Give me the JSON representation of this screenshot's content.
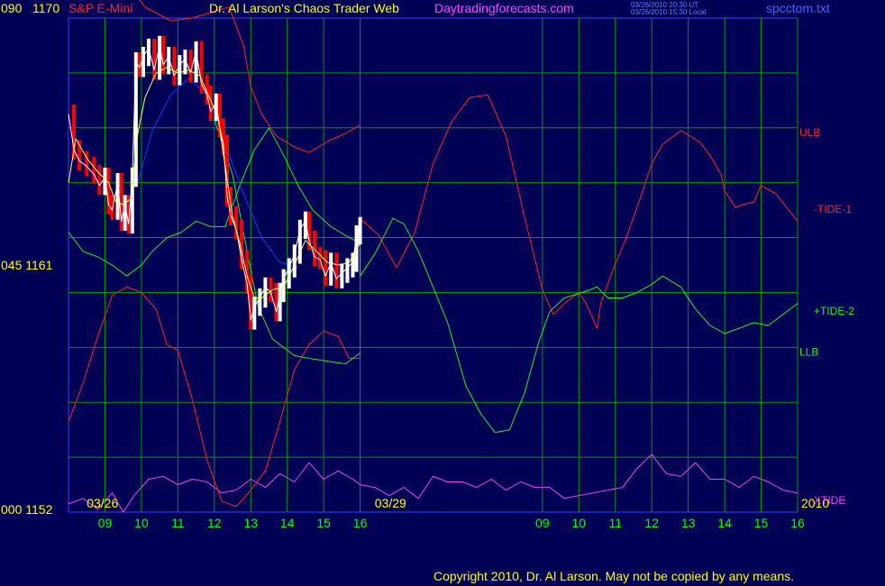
{
  "header": {
    "left_value": "090",
    "left_price": "1170",
    "symbol": "S&P E-Mini",
    "title": "Dr. Al Larson's Chaos Trader Web",
    "site": "Daytradingforecasts.com",
    "timestamp_ut": "03/26/2010 20:30 UT",
    "timestamp_local": "03/26/2010 15:30 Local",
    "filename": "spcctom.txt"
  },
  "footer": {
    "copyright": "Copyright 2010, Dr. Al Larson. May not be copied by any means."
  },
  "colors": {
    "background": "#000055",
    "grid": "#009900",
    "plot_border": "#3344ff",
    "price_up": "#ffffff",
    "price_down": "#ff0000",
    "average": "#ffff66",
    "ulb": "#ff2222",
    "tide1": "#ff2222",
    "tide2": "#22ee22",
    "llb": "#22ee22",
    "xtide": "#ee44ee",
    "slow_line": "#2233ff"
  },
  "chart_data": {
    "type": "line",
    "title": "S&P E-Mini",
    "y_left_ticks": [
      {
        "label": "090 1170",
        "value": 1170
      },
      {
        "label": "045 1161",
        "value": 1161
      },
      {
        "label": "000 1152",
        "value": 1152
      }
    ],
    "ylim": [
      1152,
      1170
    ],
    "x_hour_labels": [
      "09",
      "10",
      "11",
      "12",
      "13",
      "14",
      "15",
      "16",
      "09",
      "10",
      "11",
      "12",
      "13",
      "14",
      "15",
      "16"
    ],
    "date_labels": [
      "03/26",
      "03/29"
    ],
    "year_label": "2010",
    "series_labels": [
      "ULB",
      "-TIDE-1",
      "+TIDE-2",
      "LLB",
      "XTIDE"
    ],
    "session_close_x": 16.0,
    "price": [
      [
        8.0,
        1166.5
      ],
      [
        8.15,
        1165.2
      ],
      [
        8.3,
        1164.8
      ],
      [
        8.5,
        1164.6
      ],
      [
        8.7,
        1164.3
      ],
      [
        8.85,
        1163.9
      ],
      [
        9.0,
        1164.2
      ],
      [
        9.1,
        1163.2
      ],
      [
        9.2,
        1163.0
      ],
      [
        9.35,
        1164.0
      ],
      [
        9.45,
        1162.6
      ],
      [
        9.55,
        1163.2
      ],
      [
        9.65,
        1162.5
      ],
      [
        9.75,
        1164.2
      ],
      [
        9.85,
        1168.4
      ],
      [
        9.95,
        1168.2
      ],
      [
        10.05,
        1168.6
      ],
      [
        10.2,
        1168.9
      ],
      [
        10.35,
        1168.1
      ],
      [
        10.5,
        1169.0
      ],
      [
        10.6,
        1168.3
      ],
      [
        10.75,
        1168.6
      ],
      [
        10.9,
        1167.9
      ],
      [
        11.05,
        1168.3
      ],
      [
        11.2,
        1168.5
      ],
      [
        11.35,
        1168.0
      ],
      [
        11.5,
        1168.8
      ],
      [
        11.65,
        1167.6
      ],
      [
        11.8,
        1167.2
      ],
      [
        11.9,
        1166.6
      ],
      [
        12.05,
        1166.9
      ],
      [
        12.15,
        1166.0
      ],
      [
        12.25,
        1165.4
      ],
      [
        12.35,
        1163.5
      ],
      [
        12.45,
        1162.8
      ],
      [
        12.6,
        1162.3
      ],
      [
        12.75,
        1161.2
      ],
      [
        12.9,
        1160.3
      ],
      [
        13.0,
        1159.0
      ],
      [
        13.1,
        1159.5
      ],
      [
        13.25,
        1159.8
      ],
      [
        13.4,
        1160.2
      ],
      [
        13.55,
        1160.0
      ],
      [
        13.7,
        1159.3
      ],
      [
        13.8,
        1160.0
      ],
      [
        13.9,
        1160.5
      ],
      [
        14.05,
        1160.9
      ],
      [
        14.2,
        1161.4
      ],
      [
        14.35,
        1162.3
      ],
      [
        14.5,
        1162.6
      ],
      [
        14.6,
        1161.9
      ],
      [
        14.75,
        1161.3
      ],
      [
        14.9,
        1161.2
      ],
      [
        15.05,
        1160.6
      ],
      [
        15.2,
        1161.1
      ],
      [
        15.35,
        1160.5
      ],
      [
        15.5,
        1160.7
      ],
      [
        15.65,
        1160.9
      ],
      [
        15.8,
        1161.1
      ],
      [
        15.9,
        1162.1
      ],
      [
        16.0,
        1162.4
      ]
    ],
    "average": [
      [
        8.0,
        1164.0
      ],
      [
        8.2,
        1165.6
      ],
      [
        8.5,
        1164.9
      ],
      [
        8.8,
        1164.4
      ],
      [
        9.1,
        1164.0
      ],
      [
        9.3,
        1163.3
      ],
      [
        9.5,
        1163.2
      ],
      [
        9.7,
        1163.4
      ],
      [
        9.9,
        1165.8
      ],
      [
        10.1,
        1167.1
      ],
      [
        10.4,
        1168.0
      ],
      [
        10.7,
        1168.2
      ],
      [
        11.0,
        1168.0
      ],
      [
        11.3,
        1168.1
      ],
      [
        11.6,
        1167.9
      ],
      [
        11.9,
        1167.0
      ],
      [
        12.1,
        1166.4
      ],
      [
        12.3,
        1164.6
      ],
      [
        12.5,
        1162.8
      ],
      [
        12.7,
        1161.8
      ],
      [
        12.9,
        1160.6
      ],
      [
        13.1,
        1159.8
      ],
      [
        13.3,
        1159.8
      ],
      [
        13.6,
        1160.1
      ],
      [
        13.9,
        1160.2
      ],
      [
        14.2,
        1161.0
      ],
      [
        14.5,
        1161.9
      ],
      [
        14.8,
        1161.5
      ],
      [
        15.1,
        1161.1
      ],
      [
        15.4,
        1161.0
      ],
      [
        15.7,
        1161.1
      ],
      [
        16.0,
        1161.8
      ]
    ],
    "slow_line": [
      [
        9.9,
        1164.0
      ],
      [
        10.3,
        1165.9
      ],
      [
        10.8,
        1167.2
      ],
      [
        11.3,
        1167.8
      ],
      [
        11.8,
        1167.2
      ],
      [
        12.3,
        1165.4
      ],
      [
        12.8,
        1163.6
      ],
      [
        13.3,
        1162.0
      ],
      [
        13.8,
        1161.1
      ],
      [
        14.3,
        1160.9
      ]
    ],
    "ulb": [
      [
        9.7,
        1171.1
      ],
      [
        10.1,
        1170.4
      ],
      [
        10.8,
        1169.9
      ],
      [
        11.4,
        1170.0
      ],
      [
        11.9,
        1170.2
      ],
      [
        12.4,
        1170.4
      ],
      [
        12.8,
        1169.0
      ],
      [
        13.0,
        1167.5
      ],
      [
        13.3,
        1166.5
      ],
      [
        13.7,
        1165.7
      ],
      [
        14.2,
        1165.3
      ],
      [
        14.6,
        1165.1
      ],
      [
        15.1,
        1165.5
      ],
      [
        15.6,
        1165.8
      ],
      [
        16.0,
        1166.1
      ]
    ],
    "llb": [
      [
        12.0,
        1166.3
      ],
      [
        12.5,
        1164.3
      ],
      [
        12.9,
        1161.5
      ],
      [
        13.2,
        1159.5
      ],
      [
        13.6,
        1158.3
      ],
      [
        14.2,
        1157.7
      ],
      [
        14.6,
        1157.6
      ],
      [
        15.1,
        1157.5
      ],
      [
        15.6,
        1157.4
      ],
      [
        16.0,
        1157.8
      ]
    ],
    "tide1": [
      [
        8.0,
        1155.3
      ],
      [
        8.4,
        1156.7
      ],
      [
        8.8,
        1158.4
      ],
      [
        9.2,
        1159.9
      ],
      [
        9.6,
        1160.2
      ],
      [
        10.0,
        1160.0
      ],
      [
        10.4,
        1159.4
      ],
      [
        10.7,
        1158.1
      ],
      [
        11.0,
        1157.9
      ],
      [
        11.4,
        1156.1
      ],
      [
        11.8,
        1153.9
      ],
      [
        12.2,
        1152.4
      ],
      [
        12.6,
        1152.2
      ],
      [
        13.0,
        1152.8
      ],
      [
        13.4,
        1153.5
      ],
      [
        13.8,
        1155.3
      ],
      [
        14.2,
        1157.2
      ],
      [
        14.6,
        1158.1
      ],
      [
        15.0,
        1158.6
      ],
      [
        15.4,
        1158.4
      ],
      [
        15.7,
        1157.6
      ],
      [
        16.0,
        1157.6
      ],
      [
        16.0,
        1162.7
      ],
      [
        16.5,
        1162.1
      ],
      [
        17.0,
        1160.9
      ],
      [
        17.5,
        1162.2
      ],
      [
        18.0,
        1164.7
      ],
      [
        18.5,
        1166.2
      ],
      [
        19.0,
        1167.1
      ],
      [
        19.5,
        1167.2
      ],
      [
        20.0,
        1165.7
      ],
      [
        20.5,
        1162.8
      ],
      [
        21.0,
        1160.1
      ],
      [
        21.3,
        1159.2
      ],
      [
        21.6,
        1159.6
      ],
      [
        22.0,
        1160.0
      ],
      [
        22.2,
        1159.6
      ],
      [
        22.5,
        1158.7
      ],
      [
        22.6,
        1159.6
      ],
      [
        22.9,
        1160.7
      ],
      [
        23.3,
        1162.0
      ],
      [
        23.7,
        1163.5
      ],
      [
        24.0,
        1164.7
      ],
      [
        24.3,
        1165.4
      ],
      [
        24.8,
        1165.9
      ],
      [
        25.3,
        1165.5
      ],
      [
        25.6,
        1165.0
      ],
      [
        25.9,
        1164.3
      ],
      [
        26.0,
        1163.7
      ],
      [
        26.3,
        1163.1
      ],
      [
        26.5,
        1163.2
      ],
      [
        26.8,
        1163.3
      ],
      [
        27.0,
        1163.9
      ],
      [
        27.4,
        1163.6
      ],
      [
        27.7,
        1163.1
      ],
      [
        28.0,
        1162.6
      ]
    ],
    "tide2": [
      [
        8.0,
        1162.2
      ],
      [
        8.4,
        1161.5
      ],
      [
        8.8,
        1161.3
      ],
      [
        9.2,
        1161.0
      ],
      [
        9.6,
        1160.6
      ],
      [
        10.0,
        1161.0
      ],
      [
        10.3,
        1161.5
      ],
      [
        10.7,
        1162.0
      ],
      [
        11.1,
        1162.2
      ],
      [
        11.5,
        1162.6
      ],
      [
        11.9,
        1162.4
      ],
      [
        12.3,
        1162.4
      ],
      [
        12.7,
        1163.9
      ],
      [
        13.1,
        1165.2
      ],
      [
        13.5,
        1166.0
      ],
      [
        13.9,
        1165.0
      ],
      [
        14.3,
        1163.9
      ],
      [
        14.7,
        1163.0
      ],
      [
        15.2,
        1162.4
      ],
      [
        15.7,
        1162.0
      ],
      [
        16.0,
        1161.8
      ],
      [
        16.0,
        1160.6
      ],
      [
        16.4,
        1161.4
      ],
      [
        16.9,
        1162.7
      ],
      [
        17.2,
        1162.5
      ],
      [
        17.6,
        1161.5
      ],
      [
        18.0,
        1160.2
      ],
      [
        18.4,
        1158.9
      ],
      [
        18.9,
        1156.6
      ],
      [
        19.3,
        1155.6
      ],
      [
        19.7,
        1154.9
      ],
      [
        20.1,
        1155.0
      ],
      [
        20.5,
        1156.3
      ],
      [
        20.9,
        1158.2
      ],
      [
        21.2,
        1159.3
      ],
      [
        21.6,
        1159.8
      ],
      [
        22.1,
        1160.0
      ],
      [
        22.5,
        1160.2
      ],
      [
        22.8,
        1159.8
      ],
      [
        23.2,
        1159.8
      ],
      [
        23.6,
        1160.0
      ],
      [
        24.0,
        1160.3
      ],
      [
        24.3,
        1160.6
      ],
      [
        24.8,
        1160.2
      ],
      [
        25.2,
        1159.4
      ],
      [
        25.6,
        1158.8
      ],
      [
        26.0,
        1158.5
      ],
      [
        26.4,
        1158.7
      ],
      [
        26.8,
        1158.9
      ],
      [
        27.2,
        1158.8
      ],
      [
        27.6,
        1159.2
      ],
      [
        28.0,
        1159.6
      ]
    ],
    "xtide": [
      [
        8.0,
        1152.3
      ],
      [
        8.4,
        1152.5
      ],
      [
        8.8,
        1152.1
      ],
      [
        9.2,
        1152.7
      ],
      [
        9.5,
        1152.0
      ],
      [
        9.8,
        1152.6
      ],
      [
        10.2,
        1153.2
      ],
      [
        10.6,
        1153.3
      ],
      [
        11.0,
        1153.0
      ],
      [
        11.4,
        1153.2
      ],
      [
        11.8,
        1153.1
      ],
      [
        12.2,
        1152.7
      ],
      [
        12.6,
        1152.8
      ],
      [
        13.0,
        1153.2
      ],
      [
        13.4,
        1152.9
      ],
      [
        13.8,
        1153.4
      ],
      [
        14.2,
        1153.1
      ],
      [
        14.6,
        1153.8
      ],
      [
        15.0,
        1153.2
      ],
      [
        15.4,
        1153.5
      ],
      [
        15.8,
        1153.2
      ],
      [
        16.0,
        1153.0
      ],
      [
        16.4,
        1152.9
      ],
      [
        16.8,
        1152.6
      ],
      [
        17.2,
        1152.9
      ],
      [
        17.6,
        1152.5
      ],
      [
        18.0,
        1153.3
      ],
      [
        18.4,
        1153.1
      ],
      [
        18.8,
        1153.1
      ],
      [
        19.2,
        1152.9
      ],
      [
        19.6,
        1153.2
      ],
      [
        20.0,
        1152.8
      ],
      [
        20.4,
        1153.1
      ],
      [
        20.8,
        1152.9
      ],
      [
        21.2,
        1152.9
      ],
      [
        21.6,
        1152.5
      ],
      [
        22.0,
        1152.6
      ],
      [
        22.4,
        1152.7
      ],
      [
        22.8,
        1152.8
      ],
      [
        23.2,
        1152.9
      ],
      [
        23.6,
        1153.6
      ],
      [
        24.0,
        1154.1
      ],
      [
        24.4,
        1153.4
      ],
      [
        24.8,
        1153.3
      ],
      [
        25.2,
        1153.8
      ],
      [
        25.6,
        1153.2
      ],
      [
        26.0,
        1153.2
      ],
      [
        26.4,
        1152.9
      ],
      [
        26.8,
        1153.3
      ],
      [
        27.2,
        1153.1
      ],
      [
        27.6,
        1152.8
      ],
      [
        28.0,
        1152.7
      ]
    ]
  }
}
